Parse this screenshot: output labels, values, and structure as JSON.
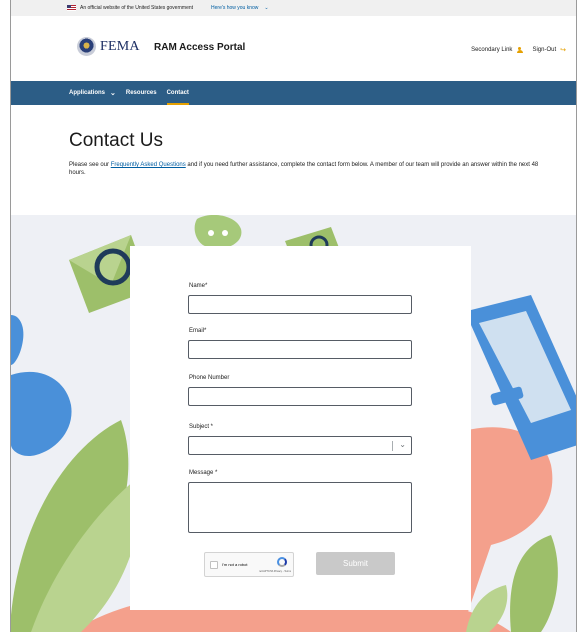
{
  "gov_banner": {
    "text": "An official website of the United States government",
    "link": "Here's how you know"
  },
  "header": {
    "logo_text": "FEMA",
    "portal_title": "RAM Access Portal",
    "secondary_link": "Secondary Link",
    "sign_out": "Sign-Out"
  },
  "nav": {
    "items": [
      {
        "label": "Applications",
        "has_dropdown": true
      },
      {
        "label": "Resources"
      },
      {
        "label": "Contact",
        "active": true
      }
    ]
  },
  "intro": {
    "title": "Contact Us",
    "text_before_link": "Please see our ",
    "link_text": "Frequently Asked Questions",
    "text_after_link": " and if you need further assistance, complete the contact form below. A member of our team will provide an answer within the next 48 hours."
  },
  "form": {
    "name_label": "Name*",
    "email_label": "Email*",
    "phone_label": "Phone Number",
    "subject_label": "Subject *",
    "message_label": "Message *",
    "captcha_text": "I'm not a robot",
    "captcha_terms": "reCAPTCHA Privacy - Terms",
    "submit_label": "Submit"
  },
  "colors": {
    "nav_bg": "#2c5d86",
    "accent": "#e5a000",
    "link": "#005ea2",
    "submit_disabled": "#c9c9c9"
  }
}
